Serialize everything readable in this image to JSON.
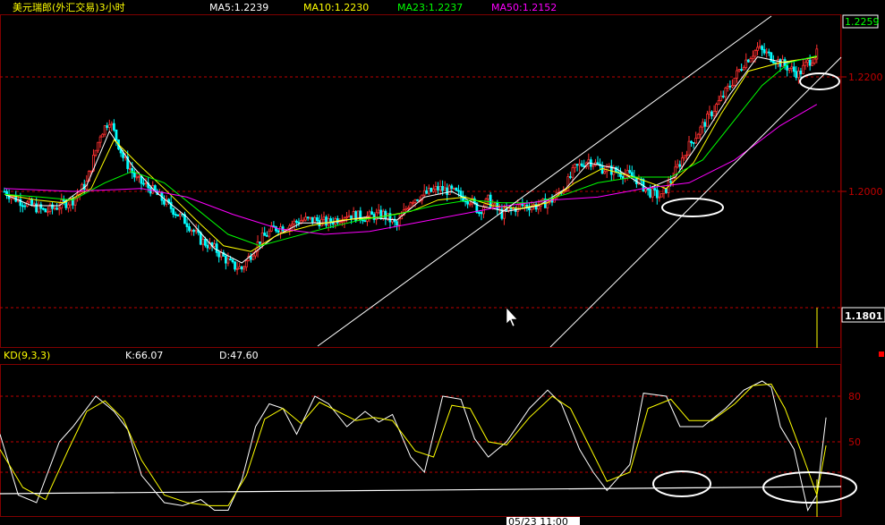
{
  "chart_data": [
    {
      "type": "candlestick",
      "title": "美元瑞郎(外汇交易)3小时",
      "indicators": [
        {
          "label": "MA5:1.2239",
          "color": "#ffffff"
        },
        {
          "label": "MA10:1.2230",
          "color": "#ffff00"
        },
        {
          "label": "MA23:1.2237",
          "color": "#00ff00"
        },
        {
          "label": "MA50:1.2152",
          "color": "#ff00ff"
        }
      ],
      "y_ticks": [
        "1.2259",
        "1.2200",
        "1.2000",
        "1.1801"
      ],
      "ylim": [
        1.18,
        1.2275
      ],
      "current_price": "1.2259",
      "cursor_price": "1.1801",
      "x_label_visible": "05/23 11:00",
      "close_path": [
        [
          0,
          1.2
        ],
        [
          6,
          1.1985
        ],
        [
          12,
          1.1975
        ],
        [
          18,
          1.1965
        ],
        [
          24,
          1.1975
        ],
        [
          30,
          1.1985
        ],
        [
          36,
          1.2015
        ],
        [
          42,
          1.21
        ],
        [
          46,
          1.2125
        ],
        [
          52,
          1.206
        ],
        [
          58,
          1.202
        ],
        [
          64,
          1.2005
        ],
        [
          72,
          1.1975
        ],
        [
          80,
          1.1945
        ],
        [
          86,
          1.1915
        ],
        [
          92,
          1.19
        ],
        [
          100,
          1.187
        ],
        [
          104,
          1.1865
        ],
        [
          112,
          1.1915
        ],
        [
          118,
          1.1935
        ],
        [
          124,
          1.194
        ],
        [
          130,
          1.195
        ],
        [
          136,
          1.195
        ],
        [
          142,
          1.1945
        ],
        [
          150,
          1.196
        ],
        [
          158,
          1.1955
        ],
        [
          166,
          1.196
        ],
        [
          172,
          1.194
        ],
        [
          178,
          1.1985
        ],
        [
          184,
          1.1995
        ],
        [
          190,
          1.2005
        ],
        [
          196,
          1.2
        ],
        [
          204,
          1.1985
        ],
        [
          208,
          1.1965
        ],
        [
          212,
          1.1985
        ],
        [
          218,
          1.196
        ],
        [
          226,
          1.1975
        ],
        [
          234,
          1.1975
        ],
        [
          240,
          1.1985
        ],
        [
          246,
          1.201
        ],
        [
          250,
          1.204
        ],
        [
          256,
          1.2055
        ],
        [
          262,
          1.204
        ],
        [
          268,
          1.2035
        ],
        [
          276,
          1.2025
        ],
        [
          282,
          1.2
        ],
        [
          288,
          1.199
        ],
        [
          294,
          1.2035
        ],
        [
          300,
          1.208
        ],
        [
          306,
          1.2115
        ],
        [
          312,
          1.215
        ],
        [
          318,
          1.2185
        ],
        [
          324,
          1.2225
        ],
        [
          330,
          1.225
        ],
        [
          336,
          1.2235
        ],
        [
          342,
          1.222
        ],
        [
          348,
          1.2205
        ],
        [
          352,
          1.2225
        ],
        [
          356,
          1.224
        ]
      ],
      "ma_paths": [
        {
          "name": "MA5",
          "color": "#ffffff",
          "points": [
            [
              0,
              1.1995
            ],
            [
              12,
              1.1975
            ],
            [
              24,
              1.1975
            ],
            [
              36,
              1.201
            ],
            [
              46,
              1.2105
            ],
            [
              56,
              1.2045
            ],
            [
              66,
              1.2
            ],
            [
              80,
              1.1955
            ],
            [
              92,
              1.19
            ],
            [
              104,
              1.1875
            ],
            [
              118,
              1.192
            ],
            [
              130,
              1.1945
            ],
            [
              142,
              1.1945
            ],
            [
              158,
              1.1955
            ],
            [
              172,
              1.195
            ],
            [
              184,
              1.199
            ],
            [
              196,
              1.2
            ],
            [
              208,
              1.1975
            ],
            [
              220,
              1.1965
            ],
            [
              234,
              1.1975
            ],
            [
              246,
              1.2005
            ],
            [
              256,
              1.205
            ],
            [
              268,
              1.204
            ],
            [
              282,
              1.2005
            ],
            [
              294,
              1.2025
            ],
            [
              306,
              1.2095
            ],
            [
              318,
              1.217
            ],
            [
              330,
              1.2235
            ],
            [
              342,
              1.2225
            ],
            [
              356,
              1.2235
            ]
          ]
        },
        {
          "name": "MA10",
          "color": "#ffff00",
          "points": [
            [
              0,
              1.1995
            ],
            [
              14,
              1.1985
            ],
            [
              26,
              1.198
            ],
            [
              38,
              1.2005
            ],
            [
              48,
              1.209
            ],
            [
              58,
              1.205
            ],
            [
              70,
              1.2005
            ],
            [
              84,
              1.195
            ],
            [
              96,
              1.1905
            ],
            [
              108,
              1.1895
            ],
            [
              120,
              1.1925
            ],
            [
              134,
              1.194
            ],
            [
              148,
              1.195
            ],
            [
              164,
              1.1955
            ],
            [
              178,
              1.1965
            ],
            [
              190,
              1.1985
            ],
            [
              202,
              1.199
            ],
            [
              214,
              1.1975
            ],
            [
              226,
              1.197
            ],
            [
              238,
              1.198
            ],
            [
              250,
              1.2015
            ],
            [
              262,
              1.204
            ],
            [
              276,
              1.2025
            ],
            [
              290,
              1.2005
            ],
            [
              302,
              1.205
            ],
            [
              314,
              1.2135
            ],
            [
              326,
              1.221
            ],
            [
              340,
              1.2225
            ],
            [
              356,
              1.2235
            ]
          ]
        },
        {
          "name": "MA23",
          "color": "#00ff00",
          "points": [
            [
              0,
              1.1995
            ],
            [
              16,
              1.199
            ],
            [
              30,
              1.1985
            ],
            [
              44,
              1.2015
            ],
            [
              56,
              1.2035
            ],
            [
              70,
              1.2015
            ],
            [
              84,
              1.197
            ],
            [
              98,
              1.1925
            ],
            [
              112,
              1.1905
            ],
            [
              126,
              1.192
            ],
            [
              140,
              1.1935
            ],
            [
              156,
              1.195
            ],
            [
              172,
              1.196
            ],
            [
              188,
              1.1975
            ],
            [
              204,
              1.1985
            ],
            [
              218,
              1.198
            ],
            [
              232,
              1.198
            ],
            [
              246,
              1.1995
            ],
            [
              260,
              1.2015
            ],
            [
              276,
              1.2025
            ],
            [
              292,
              1.2025
            ],
            [
              306,
              1.2055
            ],
            [
              318,
              1.2115
            ],
            [
              332,
              1.2185
            ],
            [
              344,
              1.2225
            ],
            [
              356,
              1.2237
            ]
          ]
        },
        {
          "name": "MA50",
          "color": "#ff00ff",
          "points": [
            [
              0,
              1.2005
            ],
            [
              30,
              1.2
            ],
            [
              60,
              1.2005
            ],
            [
              80,
              1.199
            ],
            [
              100,
              1.196
            ],
            [
              120,
              1.1935
            ],
            [
              140,
              1.1925
            ],
            [
              160,
              1.193
            ],
            [
              180,
              1.1945
            ],
            [
              200,
              1.196
            ],
            [
              220,
              1.1975
            ],
            [
              240,
              1.1985
            ],
            [
              260,
              1.199
            ],
            [
              280,
              1.2005
            ],
            [
              300,
              1.2015
            ],
            [
              320,
              1.2055
            ],
            [
              340,
              1.2115
            ],
            [
              356,
              1.2152
            ]
          ]
        }
      ]
    },
    {
      "type": "line",
      "title": "KD(9,3,3)",
      "indicators": [
        {
          "label": "K:66.07",
          "color": "#ffffff"
        },
        {
          "label": "D:47.60",
          "color": "#ffff00"
        }
      ],
      "y_ticks": [
        "80",
        "50"
      ],
      "ylim": [
        0,
        100
      ],
      "series": [
        {
          "name": "K",
          "color": "#ffffff",
          "points": [
            [
              0,
              55
            ],
            [
              8,
              15
            ],
            [
              16,
              10
            ],
            [
              26,
              50
            ],
            [
              32,
              60
            ],
            [
              42,
              80
            ],
            [
              50,
              70
            ],
            [
              56,
              58
            ],
            [
              62,
              28
            ],
            [
              72,
              10
            ],
            [
              80,
              8
            ],
            [
              88,
              12
            ],
            [
              94,
              5
            ],
            [
              100,
              5
            ],
            [
              106,
              25
            ],
            [
              112,
              60
            ],
            [
              118,
              75
            ],
            [
              124,
              72
            ],
            [
              130,
              55
            ],
            [
              138,
              80
            ],
            [
              144,
              75
            ],
            [
              152,
              60
            ],
            [
              160,
              70
            ],
            [
              166,
              63
            ],
            [
              172,
              68
            ],
            [
              180,
              40
            ],
            [
              186,
              30
            ],
            [
              194,
              80
            ],
            [
              202,
              78
            ],
            [
              208,
              52
            ],
            [
              214,
              40
            ],
            [
              222,
              50
            ],
            [
              232,
              72
            ],
            [
              240,
              84
            ],
            [
              246,
              75
            ],
            [
              254,
              45
            ],
            [
              260,
              30
            ],
            [
              266,
              18
            ],
            [
              276,
              35
            ],
            [
              282,
              82
            ],
            [
              292,
              80
            ],
            [
              298,
              60
            ],
            [
              308,
              60
            ],
            [
              318,
              72
            ],
            [
              326,
              84
            ],
            [
              334,
              90
            ],
            [
              338,
              86
            ],
            [
              342,
              60
            ],
            [
              348,
              45
            ],
            [
              354,
              5
            ],
            [
              358,
              15
            ],
            [
              362,
              66
            ]
          ]
        },
        {
          "name": "D",
          "color": "#ffff00",
          "points": [
            [
              0,
              45
            ],
            [
              10,
              20
            ],
            [
              20,
              12
            ],
            [
              30,
              45
            ],
            [
              38,
              70
            ],
            [
              46,
              77
            ],
            [
              54,
              65
            ],
            [
              62,
              38
            ],
            [
              72,
              15
            ],
            [
              82,
              10
            ],
            [
              92,
              8
            ],
            [
              100,
              8
            ],
            [
              108,
              28
            ],
            [
              116,
              65
            ],
            [
              124,
              72
            ],
            [
              132,
              62
            ],
            [
              140,
              76
            ],
            [
              148,
              70
            ],
            [
              156,
              64
            ],
            [
              164,
              66
            ],
            [
              172,
              64
            ],
            [
              182,
              44
            ],
            [
              190,
              40
            ],
            [
              198,
              74
            ],
            [
              206,
              72
            ],
            [
              214,
              50
            ],
            [
              222,
              48
            ],
            [
              232,
              66
            ],
            [
              242,
              80
            ],
            [
              250,
              72
            ],
            [
              258,
              48
            ],
            [
              266,
              24
            ],
            [
              276,
              30
            ],
            [
              284,
              72
            ],
            [
              294,
              78
            ],
            [
              302,
              64
            ],
            [
              312,
              64
            ],
            [
              322,
              75
            ],
            [
              330,
              87
            ],
            [
              338,
              88
            ],
            [
              344,
              72
            ],
            [
              352,
              40
            ],
            [
              358,
              15
            ],
            [
              362,
              47.6
            ]
          ]
        }
      ]
    }
  ]
}
